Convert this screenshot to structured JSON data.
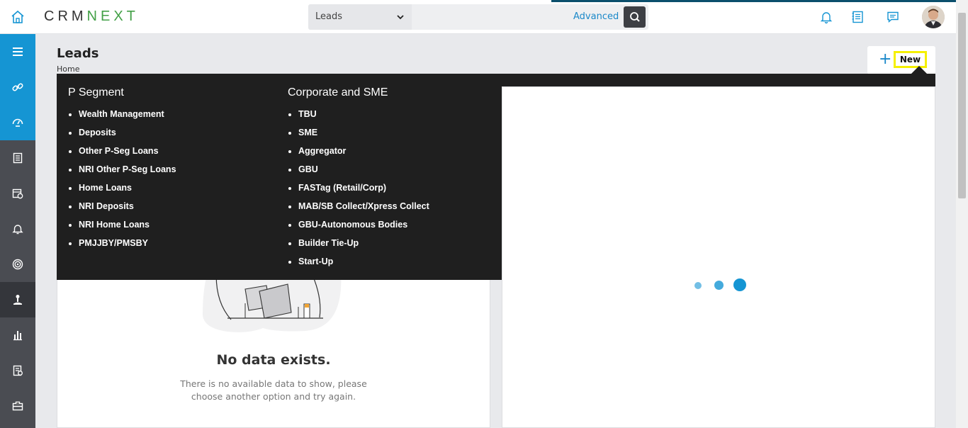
{
  "app": {
    "logo": "CRMNEXT"
  },
  "search": {
    "module": "Leads",
    "placeholder": "",
    "advanced_label": "Advanced"
  },
  "page": {
    "title": "Leads",
    "breadcrumb": "Home",
    "new_label": "New"
  },
  "menu": {
    "columns": [
      {
        "heading": "P Segment",
        "items": [
          "Wealth Management",
          "Deposits",
          "Other P-Seg Loans",
          "NRI Other P-Seg Loans",
          "Home Loans",
          "NRI Deposits",
          "NRI Home Loans",
          "PMJJBY/PMSBY"
        ]
      },
      {
        "heading": "Corporate and SME",
        "items": [
          "TBU",
          "SME",
          "Aggregator",
          "GBU",
          "FASTag (Retail/Corp)",
          "MAB/SB Collect/Xpress Collect",
          "GBU-Autonomous Bodies",
          "Builder Tie-Up",
          "Start-Up"
        ]
      }
    ]
  },
  "empty_state": {
    "title": "No data exists.",
    "description": "There is no available data to show, please choose another option and try again."
  },
  "sidebar": {
    "items": [
      "menu-icon",
      "link-icon",
      "dashboard-icon",
      "notes-icon",
      "calendar-icon",
      "bell-icon",
      "target-icon",
      "leads-icon",
      "reports-icon",
      "document-icon",
      "briefcase-icon"
    ]
  },
  "colors": {
    "accent": "#1595d3",
    "menu_bg": "#1f1f1f",
    "highlight": "#f5f000"
  }
}
